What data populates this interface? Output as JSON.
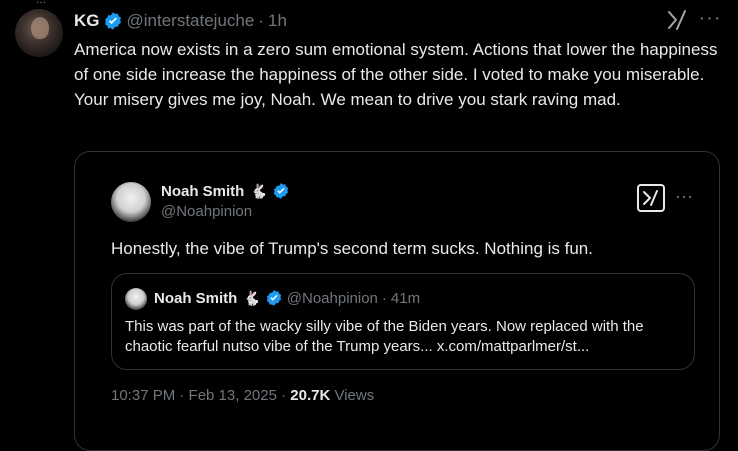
{
  "colors": {
    "background": "#000000",
    "text_primary": "#e7e9ea",
    "text_secondary": "#71767b",
    "border": "#2f3336",
    "verified_blue": "#1d9bf0"
  },
  "top_peek": {
    "text": "..."
  },
  "tweet": {
    "display_name": "KG",
    "handle": "@interstatejuche",
    "separator": "·",
    "time": "1h",
    "text": "America now exists in a zero sum emotional system. Actions that lower the happiness of one side increase the happiness of the other side. I voted to make you miserable. Your misery gives me joy, Noah. We mean to drive you stark raving mad.",
    "icons": {
      "grok": "grok-icon",
      "more": "more-icon"
    }
  },
  "quote": {
    "display_name": "Noah Smith",
    "emoji": "🐇",
    "handle": "@Noahpinion",
    "text": "Honestly, the vibe of Trump's second term sucks. Nothing is fun.",
    "nested": {
      "display_name": "Noah Smith",
      "emoji": "🐇",
      "handle": "@Noahpinion",
      "separator": "·",
      "time": "41m",
      "text": "This was part of the wacky silly vibe of the Biden years. Now replaced with the chaotic fearful nutso vibe of the Trump years... x.com/mattparlmer/st..."
    },
    "timestamp": "10:37 PM · Feb 13, 2025",
    "separator": "·",
    "views_count": "20.7K",
    "views_label": "Views"
  }
}
